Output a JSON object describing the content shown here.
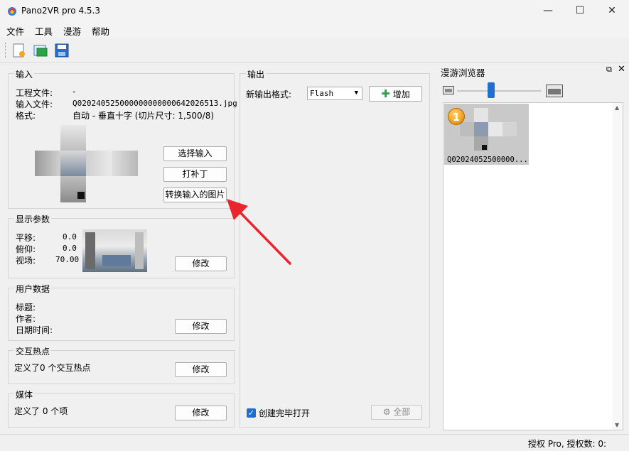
{
  "window": {
    "title": "Pano2VR pro 4.5.3",
    "minimize": "—",
    "maximize": "☐",
    "close": "✕"
  },
  "menu": {
    "file": "文件",
    "tools": "工具",
    "tour": "漫游",
    "help": "帮助"
  },
  "input_group": {
    "title": "输入",
    "project_file_label": "工程文件:",
    "project_file_value": "-",
    "input_file_label": "输入文件:",
    "input_file_value": "Q020240525000000000000642026513.jpg",
    "format_label": "格式:",
    "format_value": "自动 - 垂直十字 (切片尺寸: 1,500/8)",
    "select_input_button": "选择输入",
    "patch_button": "打补丁",
    "convert_button": "转换输入的图片"
  },
  "display_group": {
    "title": "显示参数",
    "pan_label": "平移:",
    "pan_value": "0.0",
    "tilt_label": "俯仰:",
    "tilt_value": "0.0",
    "fov_label": "视场:",
    "fov_value": "70.00",
    "modify_button": "修改"
  },
  "user_data_group": {
    "title": "用户数据",
    "title_label": "标题:",
    "author_label": "作者:",
    "datetime_label": "日期时间:",
    "modify_button": "修改"
  },
  "hotspot_group": {
    "title": "交互热点",
    "text": "定义了0 个交互热点",
    "modify_button": "修改"
  },
  "media_group": {
    "title": "媒体",
    "text": "定义了 0 个项",
    "modify_button": "修改"
  },
  "output_group": {
    "title": "输出",
    "new_format_label": "新输出格式:",
    "format_selected": "Flash",
    "add_button": "增加",
    "open_when_done": "创建完毕打开",
    "all_button": "全部"
  },
  "tour_browser": {
    "title": "漫游浏览器",
    "zoom_level": 0.4,
    "item_label": "Q02024052500000...",
    "item_badge": "1"
  },
  "statusbar": {
    "license": "授权 Pro, 授权数: 0:"
  },
  "colors": {
    "accent": "#1e6fd0",
    "arrow": "#e8262c",
    "badge": "#f0a020"
  }
}
